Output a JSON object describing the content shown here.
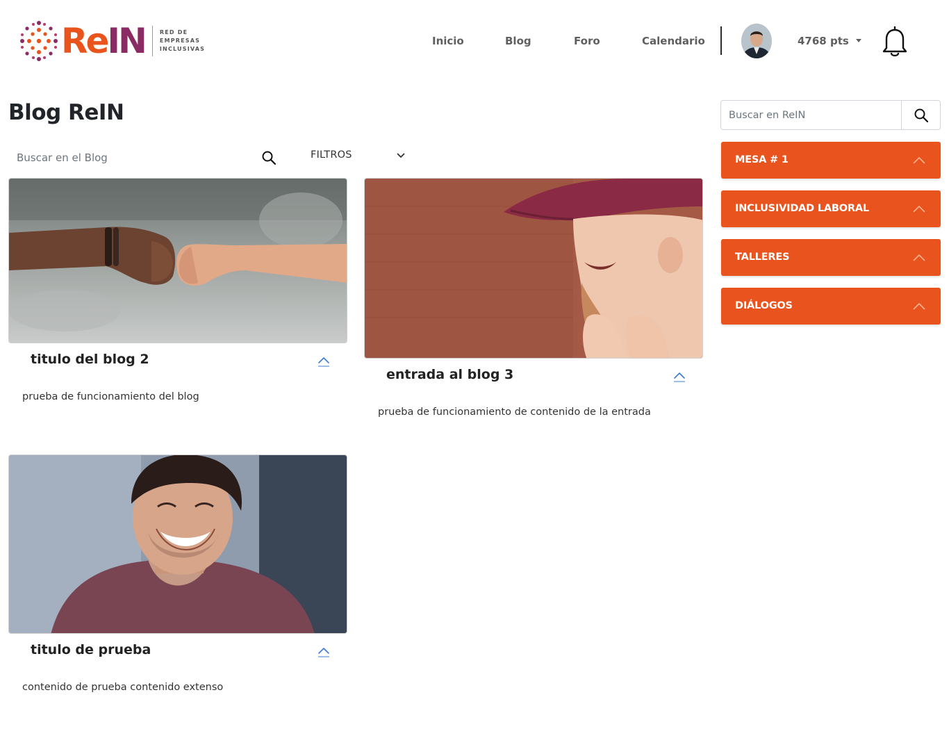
{
  "header": {
    "logo": {
      "word": "ReIN",
      "tagline": [
        "RED DE",
        "EMPRESAS",
        "INCLUSIVAS"
      ],
      "colors": {
        "orange": "#e9541c",
        "purple": "#8b2b63"
      }
    },
    "nav": [
      "Inicio",
      "Blog",
      "Foro",
      "Calendario"
    ],
    "points": "4768 pts",
    "icons": {
      "avatar": "user-avatar",
      "notifications": "bell-icon"
    }
  },
  "main": {
    "title": "Blog ReIN",
    "search_placeholder": "Buscar en el Blog",
    "filters_label": "FILTROS",
    "posts": [
      {
        "title": "titulo del blog 2",
        "body": "prueba de funcionamiento del blog",
        "image": "fist-bump-photo"
      },
      {
        "title": "entrada al blog 3",
        "body": "prueba de funcionamiento de contenido de la entrada",
        "image": "laughing-man-cap-photo"
      },
      {
        "title": "titulo de prueba",
        "body": "contenido de prueba contenido extenso",
        "image": "smiling-man-photo"
      }
    ]
  },
  "sidebar": {
    "search_placeholder": "Buscar en ReIN",
    "sections": [
      "MESA # 1",
      "INCLUSIVIDAD LABORAL",
      "TALLERES",
      "DIÁLOGOS"
    ],
    "accent_color": "#e9531d"
  }
}
